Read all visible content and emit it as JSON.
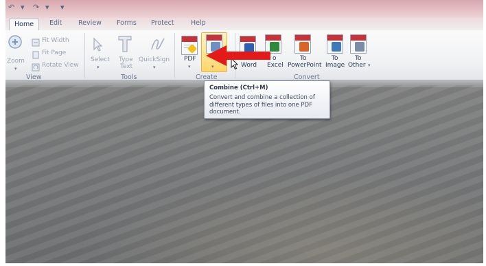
{
  "quick_access": {
    "icons": [
      "undo-icon",
      "redo-icon",
      "customize-icon"
    ],
    "separator_glyph": "▾"
  },
  "tabs": [
    "Home",
    "Edit",
    "Review",
    "Forms",
    "Protect",
    "Help"
  ],
  "active_tab": "Home",
  "ribbon": {
    "view_group": {
      "label": "View",
      "zoom_label": "Zoom",
      "fit_width": "Fit Width",
      "fit_page": "Fit Page",
      "rotate_view": "Rotate View"
    },
    "tools_group": {
      "label": "Tools",
      "select": "Select",
      "type_text_line1": "Type",
      "type_text_line2": "Text",
      "quicksign": "QuickSign"
    },
    "create_group": {
      "label": "Create",
      "pdf": "PDF"
    },
    "convert_group": {
      "label": "Convert",
      "word": "Word",
      "excel": "Excel",
      "to_powerpoint_line1": "To",
      "to_powerpoint_line2": "PowerPoint",
      "to_image_line1": "To",
      "to_image_line2": "Image",
      "to_other_line1": "To",
      "to_other_line2": "Other",
      "partial_to": "o"
    }
  },
  "tooltip": {
    "title": "Combine (Ctrl+M)",
    "body": "Convert and combine a collection of different types of files into one PDF document."
  },
  "colors": {
    "annotation_arrow": "#e21a1a",
    "pdf_red": "#c6323a",
    "word_blue": "#2f5fae",
    "excel_green": "#2f8a3c",
    "powerpoint_orange": "#d9642a"
  }
}
